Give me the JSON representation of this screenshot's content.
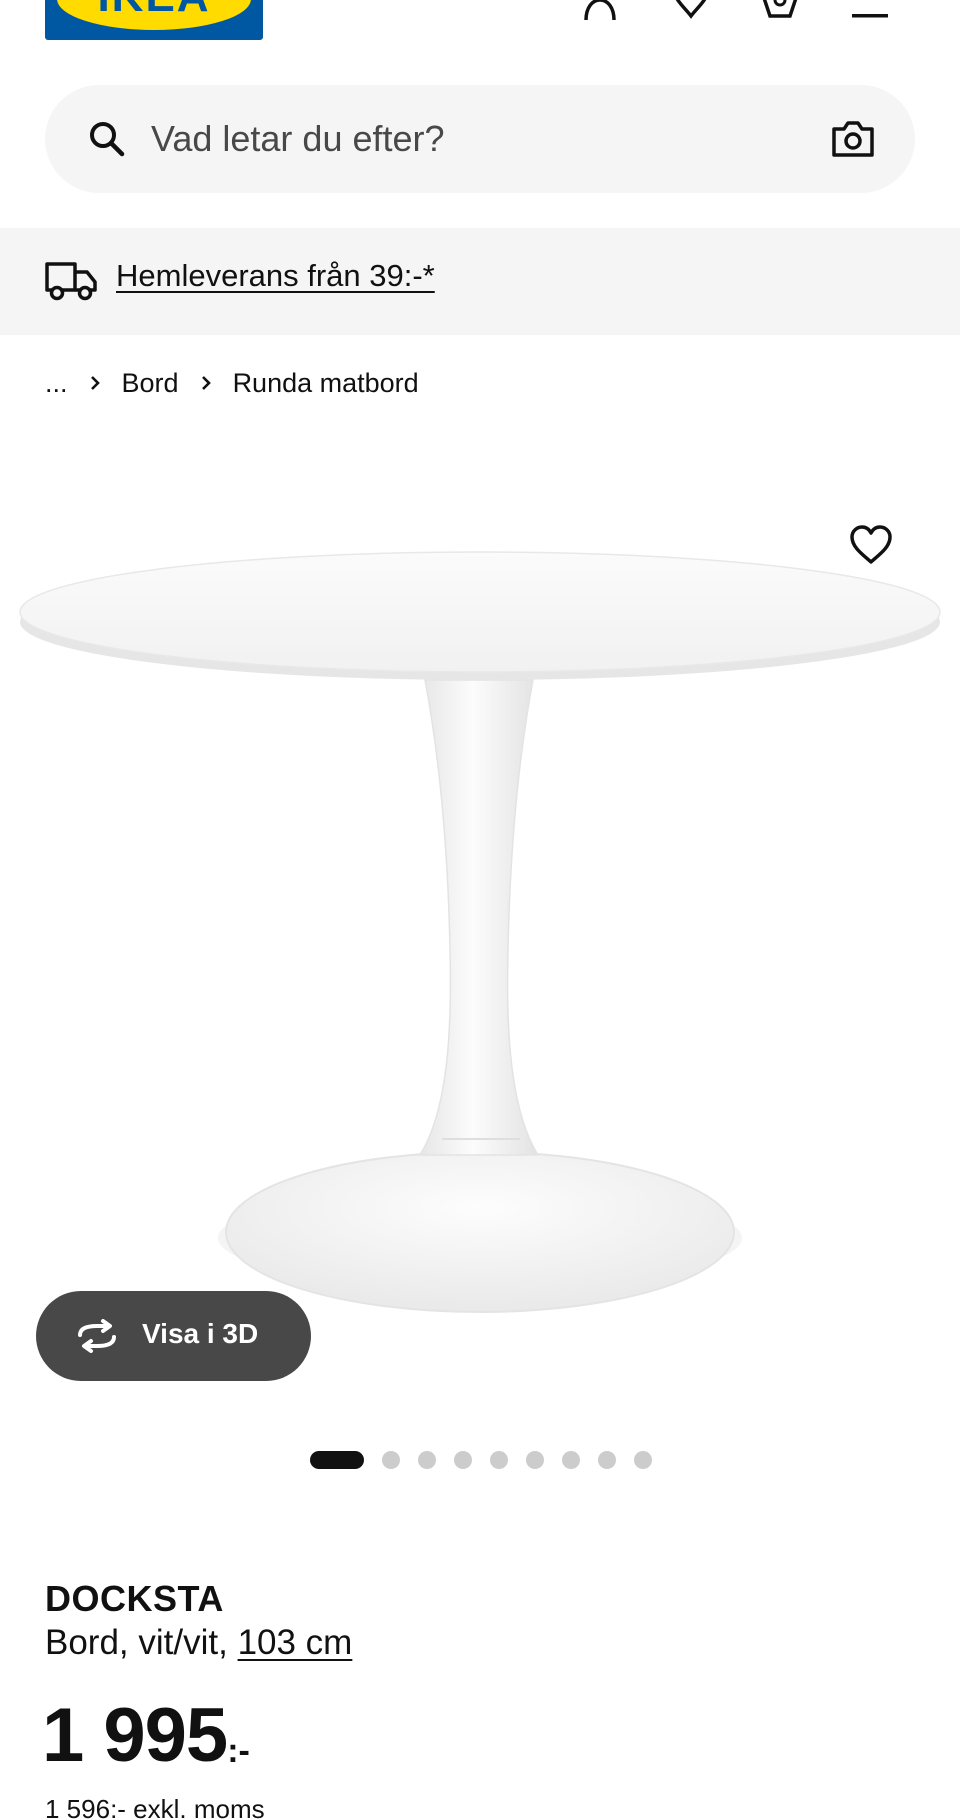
{
  "header": {
    "logo_text": "IKEA",
    "icons": [
      "account-icon",
      "heart-icon",
      "cart-icon",
      "menu-icon"
    ]
  },
  "search": {
    "placeholder": "Vad letar du efter?"
  },
  "delivery": {
    "label": "Hemleverans från 39:-*"
  },
  "breadcrumb": {
    "items": [
      "...",
      "Bord",
      "Runda matbord"
    ]
  },
  "gallery": {
    "view3d_label": "Visa i 3D",
    "image_count": 9,
    "active_index": 0
  },
  "product": {
    "name": "DOCKSTA",
    "desc_prefix": "Bord, vit/vit, ",
    "size": "103 cm",
    "price": "1 995",
    "price_suffix": ":-",
    "price_excl": "1 596:- exkl. moms"
  },
  "colors": {
    "brand_blue": "#0058a3",
    "brand_yellow": "#ffdb00",
    "surface": "#f5f5f5",
    "button_dark": "#484848"
  }
}
